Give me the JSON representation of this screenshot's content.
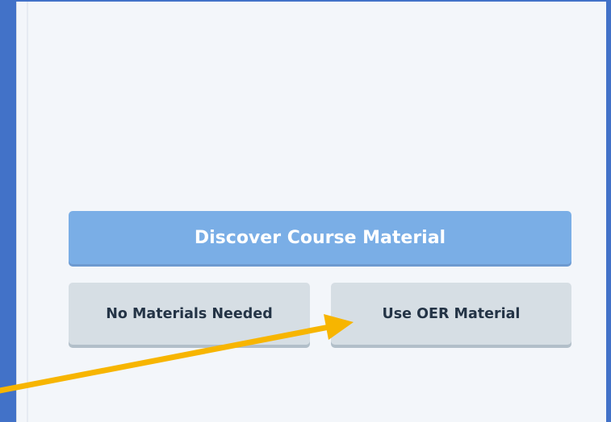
{
  "course_material": {
    "discover_label": "Discover Course Material",
    "no_materials_label": "No Materials Needed",
    "oer_label": "Use OER Material"
  },
  "colors": {
    "background": "#4272c8",
    "panel": "#f3f6fa",
    "primary_button": "#7aaee6",
    "secondary_button": "#d6dee4",
    "annotation_arrow": "#f7b500"
  }
}
